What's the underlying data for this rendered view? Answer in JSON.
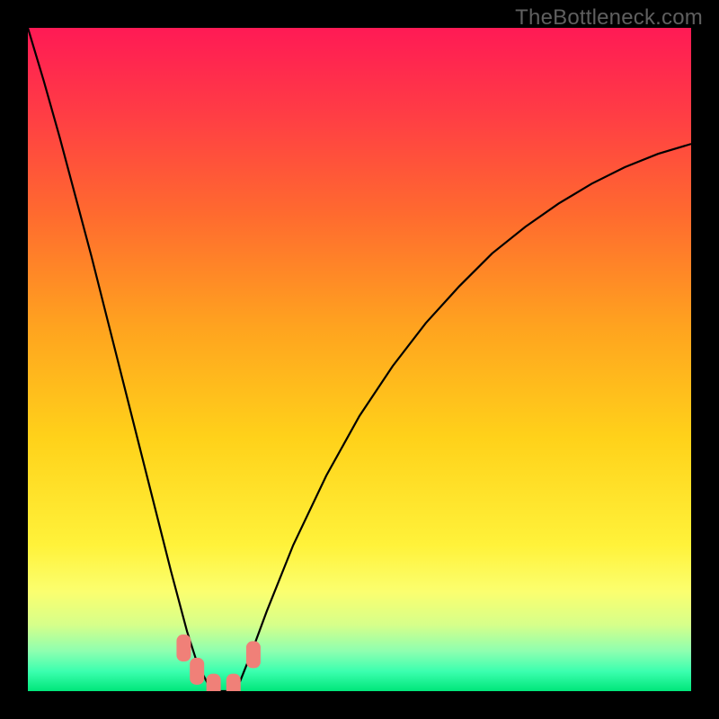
{
  "watermark": "TheBottleneck.com",
  "chart_data": {
    "type": "line",
    "title": "",
    "xlabel": "",
    "ylabel": "",
    "xlim": [
      0,
      100
    ],
    "ylim": [
      0,
      100
    ],
    "background_gradient": {
      "direction": "vertical",
      "stops": [
        {
          "pos": 0.0,
          "color": "#ff1a55"
        },
        {
          "pos": 0.12,
          "color": "#ff3a46"
        },
        {
          "pos": 0.28,
          "color": "#ff6a2f"
        },
        {
          "pos": 0.45,
          "color": "#ffa31f"
        },
        {
          "pos": 0.62,
          "color": "#ffd21a"
        },
        {
          "pos": 0.78,
          "color": "#fff23a"
        },
        {
          "pos": 0.85,
          "color": "#fbff6f"
        },
        {
          "pos": 0.9,
          "color": "#d6ff8a"
        },
        {
          "pos": 0.94,
          "color": "#8dffb0"
        },
        {
          "pos": 0.97,
          "color": "#3cffaf"
        },
        {
          "pos": 1.0,
          "color": "#00e67a"
        }
      ]
    },
    "series": [
      {
        "name": "bottleneck-curve",
        "color": "#000000",
        "x": [
          0.0,
          2.4,
          4.8,
          7.2,
          9.6,
          12.0,
          14.4,
          16.8,
          19.2,
          21.6,
          24.0,
          25.6,
          27.2,
          28.8,
          30.4,
          32.0,
          33.6,
          36.0,
          40.0,
          45.0,
          50.0,
          55.0,
          60.0,
          65.0,
          70.0,
          75.0,
          80.0,
          85.0,
          90.0,
          95.0,
          100.0
        ],
        "y": [
          100.0,
          92.0,
          83.5,
          74.5,
          65.5,
          56.0,
          46.5,
          37.0,
          27.5,
          18.0,
          9.0,
          4.0,
          1.0,
          0.0,
          0.0,
          1.5,
          5.5,
          12.0,
          22.0,
          32.5,
          41.5,
          49.0,
          55.5,
          61.0,
          66.0,
          70.0,
          73.5,
          76.5,
          79.0,
          81.0,
          82.5
        ]
      }
    ],
    "markers": [
      {
        "name": "flat-region-1",
        "x": 23.5,
        "y": 6.5,
        "color": "#f08078"
      },
      {
        "name": "flat-region-2",
        "x": 25.5,
        "y": 3.0,
        "color": "#f08078"
      },
      {
        "name": "flat-region-3",
        "x": 28.0,
        "y": 0.6,
        "color": "#f08078"
      },
      {
        "name": "flat-region-4",
        "x": 31.0,
        "y": 0.6,
        "color": "#f08078"
      },
      {
        "name": "flat-region-5",
        "x": 34.0,
        "y": 5.5,
        "color": "#f08078"
      }
    ]
  }
}
